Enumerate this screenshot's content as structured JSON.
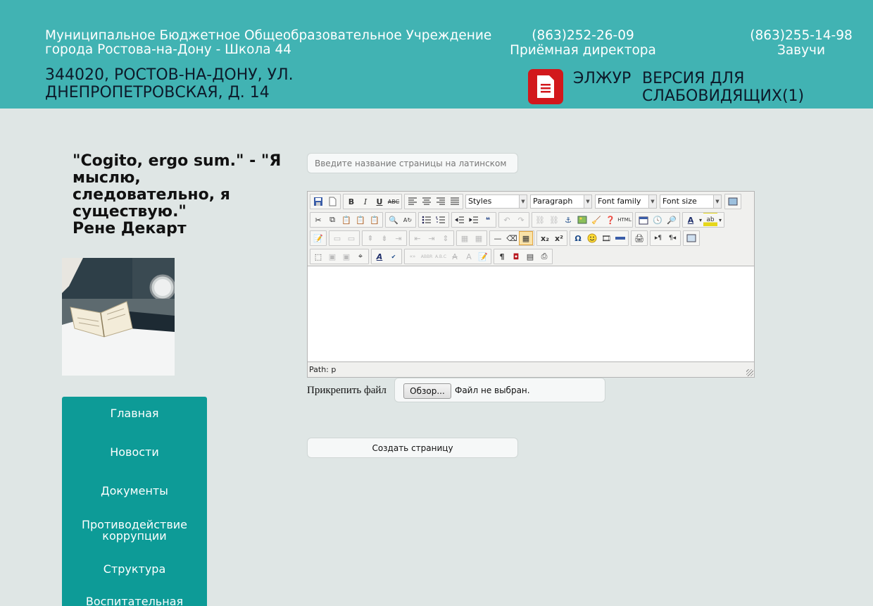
{
  "header": {
    "school_name_line1": "Муниципальное Бюджетное Общеобразовательное Учреждение",
    "school_name_line2": "города Ростова-на-Дону - Школа 44",
    "phone_director": "(863)252-26-09",
    "phone_director_caption": "Приёмная директора",
    "phone_headteachers": "(863)255-14-98",
    "phone_headteachers_caption": "Завучи",
    "address_line1": "344020, РОСТОВ-НА-ДОНУ, УЛ.",
    "address_line2": "ДНЕПРОПЕТРОВСКАЯ, Д. 14",
    "eljur_label": "ЭЛЖУР",
    "eljur_icon": "document-icon",
    "blind_version_line1": "ВЕРСИЯ ДЛЯ",
    "blind_version_line2": "СЛАБОВИДЯЩИХ(1)",
    "colors": {
      "header_bg": "#41b3b3",
      "eljur_icon_bg": "#d2181c"
    }
  },
  "sidebar": {
    "quote_line1": "\"Cogito, ergo sum.\" - \"Я",
    "quote_line2": "мыслю,",
    "quote_line3": "следовательно, я",
    "quote_line4": "существую.\"",
    "quote_author": "Рене Декарт",
    "nav": [
      {
        "label": "Главная"
      },
      {
        "label": "Новости"
      },
      {
        "label": "Документы"
      },
      {
        "label": "Противодействие"
      },
      {
        "label": "коррупции"
      },
      {
        "label": "Структура"
      },
      {
        "label": "Воспитательная система"
      }
    ],
    "colors": {
      "nav_bg": "#0d9b97"
    }
  },
  "form": {
    "page_name_placeholder": "Введите название страницы на латинском",
    "toolbar": {
      "styles": "Styles",
      "block_format": "Paragraph",
      "font_family": "Font family",
      "font_size": "Font size"
    },
    "path_label": "Path: p",
    "attach_label": "Прикрепить файл",
    "browse_button": "Обзор...",
    "file_status": "Файл не выбран.",
    "create_button": "Создать страницу"
  }
}
